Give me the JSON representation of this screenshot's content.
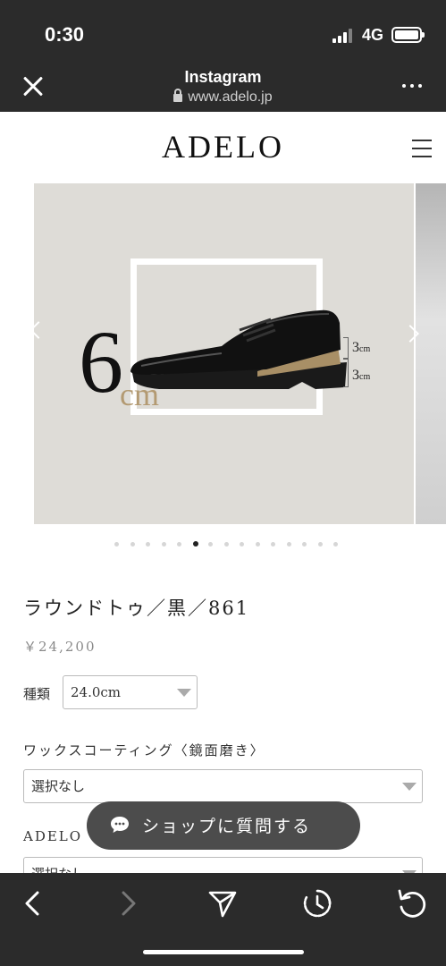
{
  "status_bar": {
    "time": "0:30",
    "network": "4G"
  },
  "browser": {
    "title": "Instagram",
    "url": "www.adelo.jp"
  },
  "site": {
    "logo": "ADELO"
  },
  "carousel": {
    "total_slides": 15,
    "active_index": 5,
    "heel_number": "6",
    "heel_unit": "cm",
    "dim_upper_value": "3",
    "dim_upper_unit": "cm",
    "dim_lower_value": "3",
    "dim_lower_unit": "cm"
  },
  "product": {
    "title": "ラウンドトゥ／黒／861",
    "price": "￥24,200",
    "type_label": "種類",
    "type_value": "24.0cm",
    "wax_label": "ワックスコーティング〈鏡面磨き〉",
    "wax_value": "選択なし",
    "adelo_label": "ADELO",
    "adelo_value": "選択なし"
  },
  "chat": {
    "label": "ショップに質問する"
  },
  "icons": {
    "close": "close-icon",
    "lock": "lock-icon",
    "more": "more-icon",
    "menu": "hamburger-icon",
    "chat": "chat-bubble-icon",
    "back": "chevron-left-icon",
    "forward": "chevron-right-icon",
    "share": "send-icon",
    "timer": "timer-icon",
    "reload": "reload-icon"
  },
  "colors": {
    "accent_gold": "#b39a72",
    "bar_dark": "#2b2b2b",
    "slide_bg": "#dedcd7"
  }
}
